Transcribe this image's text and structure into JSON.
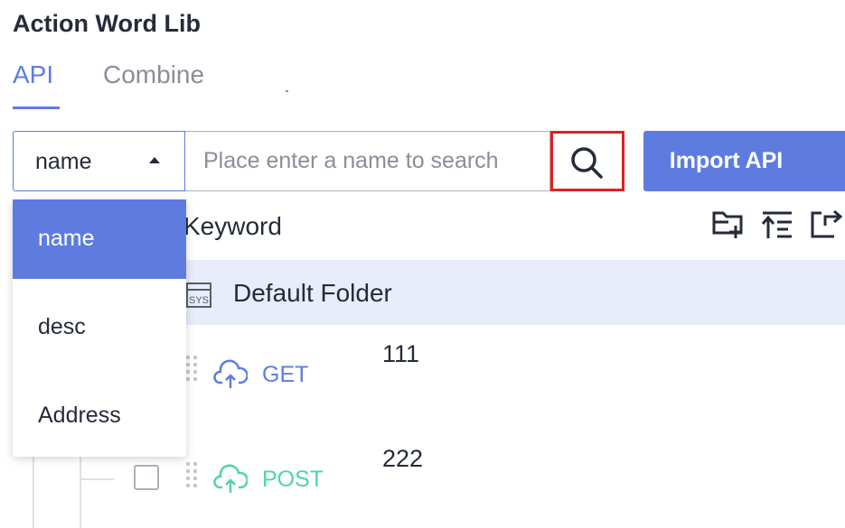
{
  "header": {
    "title": "Action Word Lib"
  },
  "tabs": [
    {
      "label": "API",
      "active": true
    },
    {
      "label": "Combine",
      "active": false
    }
  ],
  "search": {
    "field_select_value": "name",
    "placeholder": "Place enter a name to search",
    "value": ""
  },
  "toolbar": {
    "import_label": "Import API"
  },
  "tree": {
    "header_label": "Keyword",
    "folder": {
      "label": "Default Folder",
      "icon": "sys-folder-icon"
    },
    "items": [
      {
        "method": "GET",
        "name": "111"
      },
      {
        "method": "POST",
        "name": "222"
      }
    ]
  },
  "dropdown": {
    "options": [
      "name",
      "desc",
      "Address"
    ],
    "selected": "name"
  },
  "colors": {
    "accent": "#5e7ce0",
    "get_method": "#5e7ce0",
    "post_method": "#50d4ab",
    "search_highlight": "#e02020",
    "folder_row_bg": "#e9edfa"
  }
}
